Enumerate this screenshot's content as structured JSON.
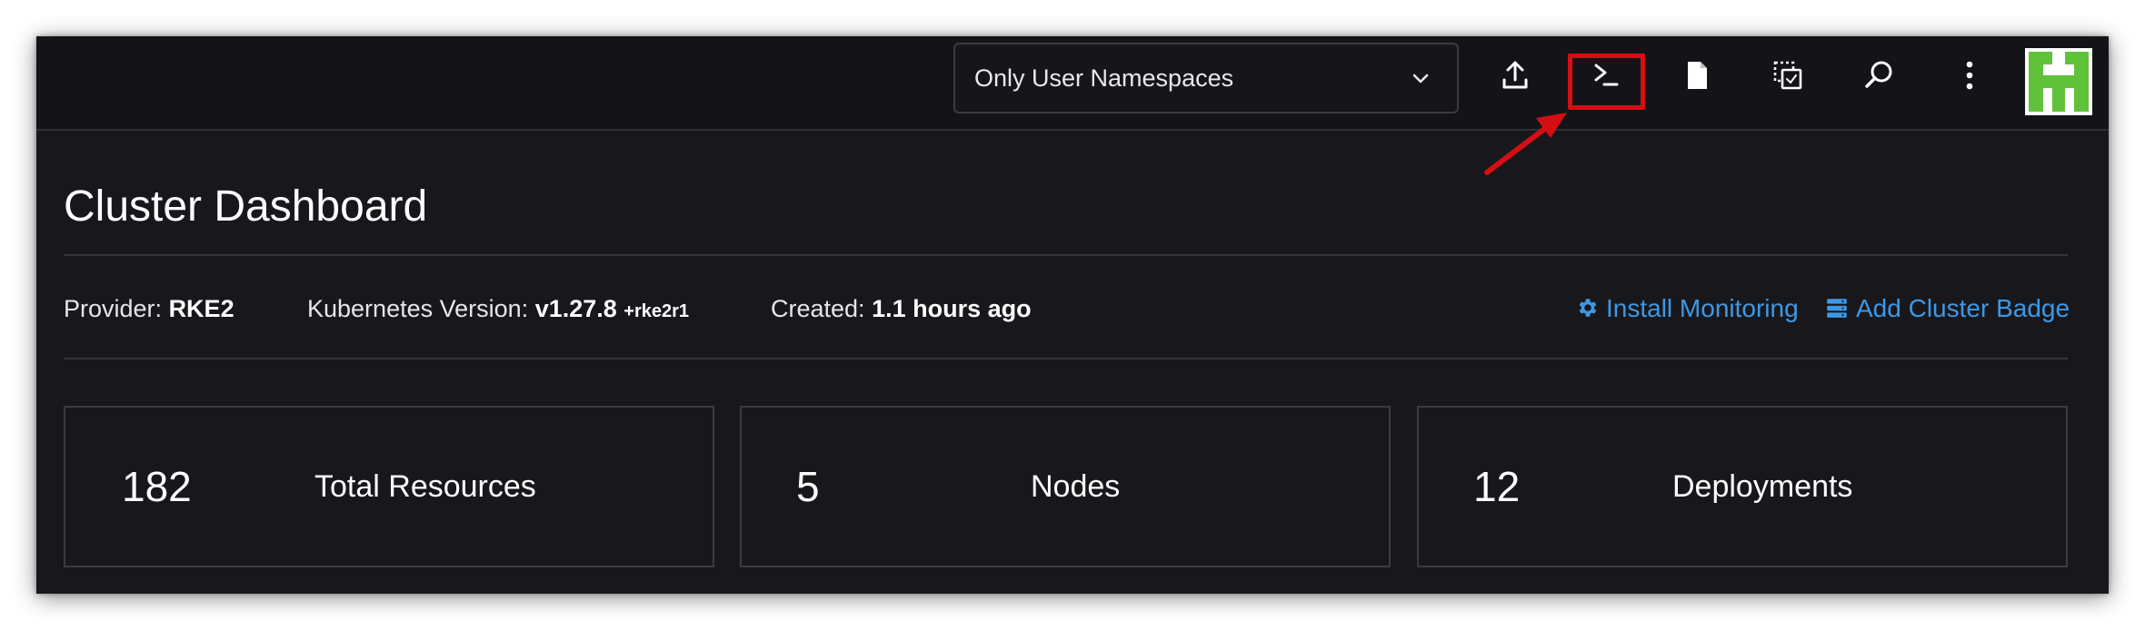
{
  "namespace_filter": {
    "selected": "Only User Namespaces"
  },
  "header_icons": [
    "upload-icon",
    "terminal-icon",
    "document-icon",
    "copy-icon",
    "search-icon",
    "more-vertical-icon"
  ],
  "page": {
    "title": "Cluster Dashboard"
  },
  "cluster_info": {
    "provider_label": "Provider:",
    "provider_value": "RKE2",
    "k8s_label": "Kubernetes Version:",
    "k8s_value": "v1.27.8",
    "k8s_suffix": "+rke2r1",
    "created_label": "Created:",
    "created_value": "1.1 hours ago"
  },
  "actions": {
    "install_monitoring": "Install Monitoring",
    "add_cluster_badge": "Add Cluster Badge"
  },
  "stats": [
    {
      "value": "182",
      "label": "Total Resources"
    },
    {
      "value": "5",
      "label": "Nodes"
    },
    {
      "value": "12",
      "label": "Deployments"
    }
  ],
  "colors": {
    "background": "#18181c",
    "link": "#3d98e6",
    "highlight": "#d40f14",
    "avatar_green": "#5fc23a"
  }
}
